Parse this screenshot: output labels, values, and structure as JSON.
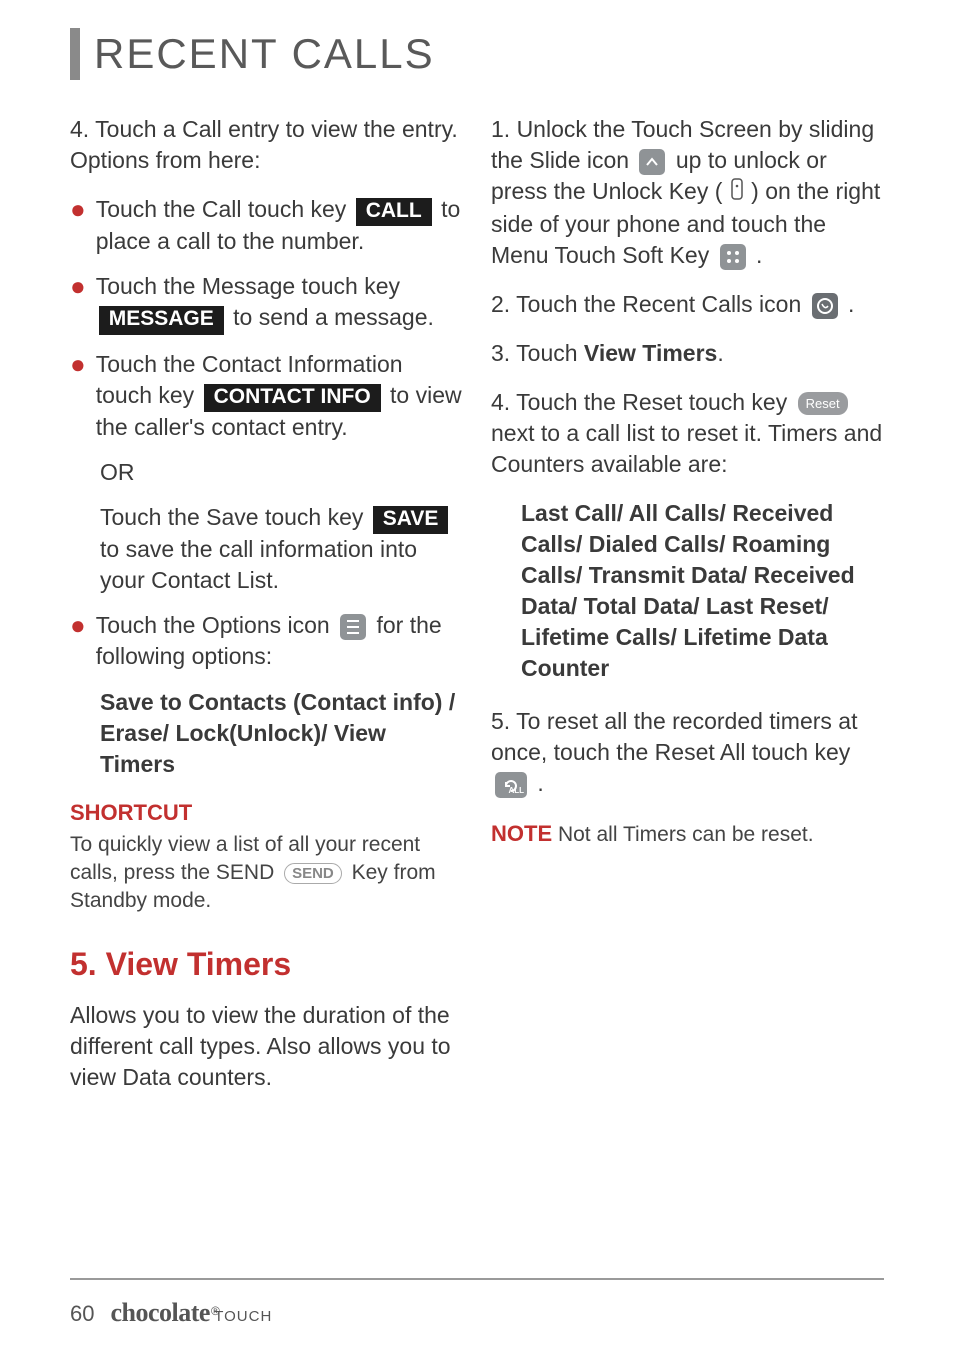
{
  "title": "RECENT CALLS",
  "left": {
    "step4": "4. Touch a Call entry to view the entry. Options from here:",
    "b_call_pre": "Touch the Call touch key ",
    "k_call": "CALL",
    "b_call_post": " to place a call to the number.",
    "b_msg_pre": "Touch the Message touch key ",
    "k_msg": "MESSAGE",
    "b_msg_post": " to send a message.",
    "b_ci_pre": "Touch the Contact Information touch key ",
    "k_ci": "CONTACT INFO",
    "b_ci_post": " to view the caller's contact entry.",
    "or": "OR",
    "b_save_pre": "Touch the Save touch key ",
    "k_save": "SAVE",
    "b_save_post": " to save the call information into your Contact List.",
    "b_opt_pre": "Touch the Options icon ",
    "b_opt_post": " for the following options:",
    "opt_list": "Save to Contacts (Contact info) / Erase/ Lock(Unlock)/ View Timers",
    "shortcut_title": "SHORTCUT",
    "shortcut_pre": "To quickly view a list of all your recent calls, press the SEND ",
    "send_label": "SEND",
    "shortcut_post": " Key from Standby mode.",
    "sec5_title": "5. View Timers",
    "sec5_body": "Allows you to view the duration of the different call types. Also allows you to view Data counters."
  },
  "right": {
    "s1_pre": "1. Unlock the Touch Screen by sliding the Slide icon ",
    "s1_mid": " up to unlock or press the Unlock Key ( ",
    "s1_mid2": " ) on the right side of your phone and touch the Menu Touch Soft Key ",
    "s1_end": " .",
    "s2_pre": "2. Touch the Recent Calls icon ",
    "s2_end": ".",
    "s3_pre": "3. Touch ",
    "s3_bold": "View Timers",
    "s3_end": ".",
    "s4_pre": "4. Touch the Reset touch key ",
    "reset_label": "Reset",
    "s4_post": " next to a call list to reset it. Timers and Counters available are:",
    "timers": "Last Call/ All Calls/ Received Calls/ Dialed Calls/ Roaming Calls/ Transmit Data/ Received Data/ Total Data/ Last Reset/ Lifetime Calls/ Lifetime Data Counter",
    "s5_pre": "5. To reset all the recorded timers at once, touch the Reset All touch key ",
    "s5_end": " .",
    "note_title": "NOTE",
    "note_body": "  Not all Timers can be reset."
  },
  "footer": {
    "page": "60",
    "brand": "chocolate",
    "reg": "®",
    "sub": "TOUCH"
  }
}
